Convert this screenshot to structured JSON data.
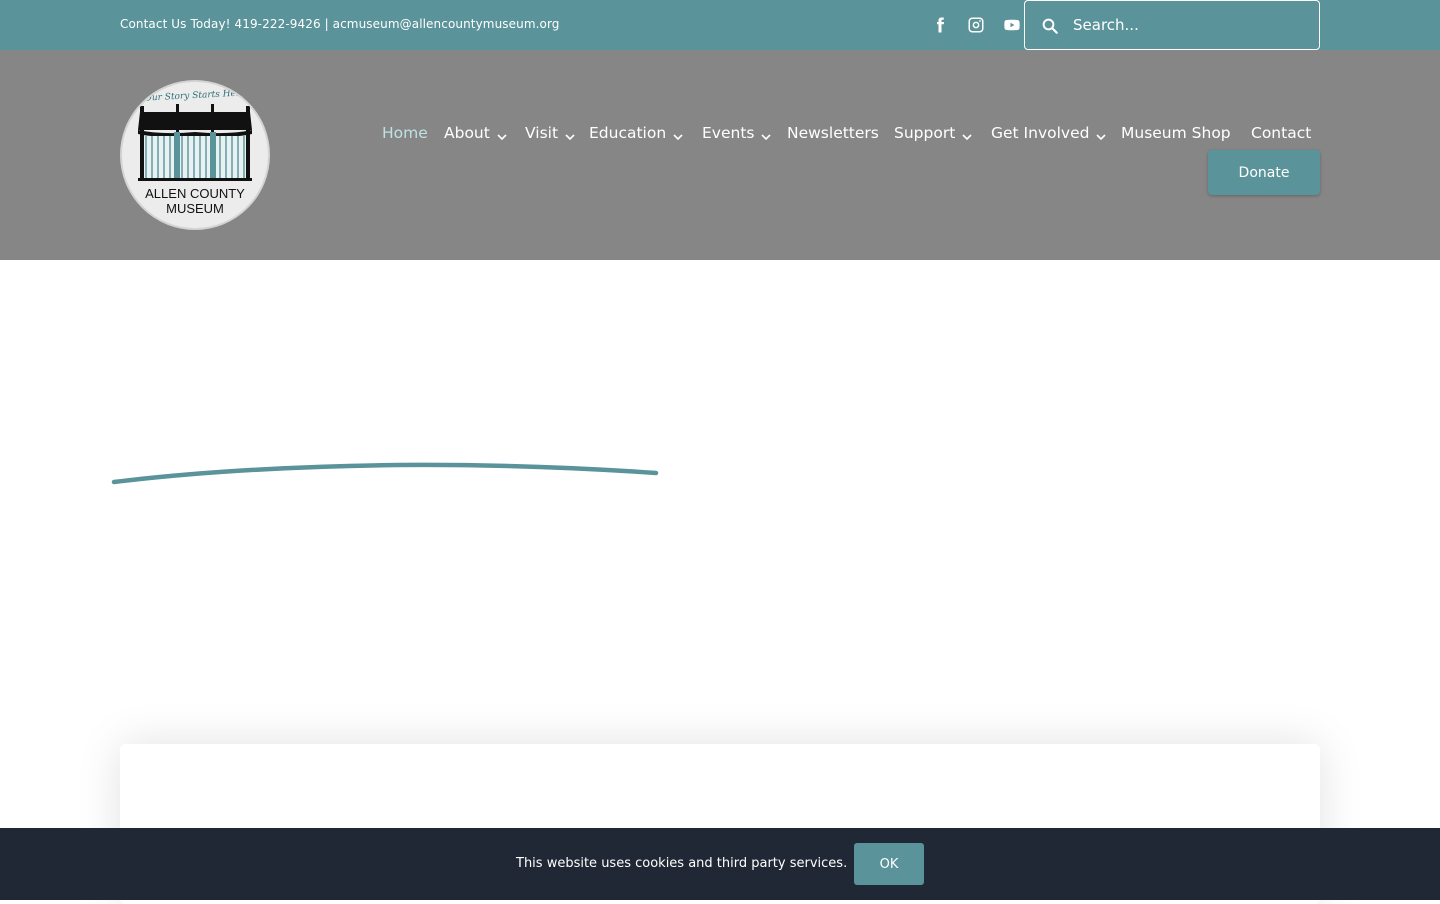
{
  "topbar": {
    "contact_text": "Contact Us Today! 419-222-9426 | acmuseum@allencountymuseum.org",
    "social": [
      {
        "name": "facebook-icon"
      },
      {
        "name": "instagram-icon"
      },
      {
        "name": "youtube-icon"
      }
    ],
    "search": {
      "placeholder": "Search..."
    }
  },
  "logo": {
    "tagline": "Our Story Starts Here",
    "line1": "ALLEN COUNTY",
    "line2": "MUSEUM"
  },
  "nav": {
    "items": [
      {
        "label": "Home",
        "active": true,
        "dropdown": false
      },
      {
        "label": "About",
        "dropdown": true
      },
      {
        "label": "Visit",
        "dropdown": true
      },
      {
        "label": "Education",
        "dropdown": true
      },
      {
        "label": "Events",
        "dropdown": true
      },
      {
        "label": "Newsletters",
        "dropdown": false
      },
      {
        "label": "Support",
        "dropdown": true
      },
      {
        "label": "Get Involved",
        "dropdown": true
      },
      {
        "label": "Museum Shop",
        "dropdown": false
      },
      {
        "label": "Contact",
        "dropdown": false
      }
    ],
    "donate_label": "Donate"
  },
  "cookie": {
    "text": "This website uses cookies and third party services.",
    "ok_label": "OK"
  },
  "colors": {
    "accent": "#5a9399",
    "header_bg": "#868686",
    "cookie_bg": "#202836",
    "active_nav": "#bfe1e3"
  }
}
